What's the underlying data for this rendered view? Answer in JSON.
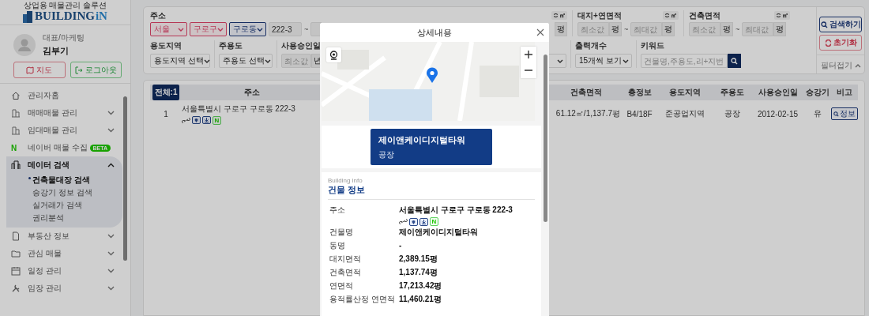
{
  "sidebar": {
    "logo": {
      "tagline": "상업용 매물관리 솔루션",
      "word": "BUILDING",
      "accent": "iN"
    },
    "user": {
      "role": "대표/마케팅",
      "name": "김부기"
    },
    "buttons": [
      {
        "label": "지도",
        "kind": "map"
      },
      {
        "label": "로그아웃",
        "kind": "logout"
      }
    ],
    "menu": [
      {
        "label": "관리자홈",
        "kind": "link"
      },
      {
        "label": "매매매물 관리",
        "kind": "group",
        "expanded": false
      },
      {
        "label": "임대매물 관리",
        "kind": "group",
        "expanded": false
      },
      {
        "label": "네이버 매물 수집",
        "kind": "link",
        "glyph": "N",
        "badge": "BETA"
      },
      {
        "label": "데이터 검색",
        "kind": "group",
        "expanded": true,
        "children": [
          {
            "label": "건축물대장 검색",
            "selected": true
          },
          {
            "label": "승강기 정보 검색",
            "selected": false
          },
          {
            "label": "실거래가 검색",
            "selected": false
          },
          {
            "label": "권리분석",
            "selected": false
          }
        ]
      },
      {
        "label": "부동산 정보",
        "kind": "group",
        "expanded": false
      },
      {
        "label": "관심 매물",
        "kind": "group",
        "expanded": false
      },
      {
        "label": "일정 관리",
        "kind": "group",
        "expanded": false
      },
      {
        "label": "임장 관리",
        "kind": "group",
        "expanded": false
      }
    ]
  },
  "filters": {
    "address": {
      "label": "주소",
      "selects": [
        {
          "value": "서울",
          "kind": "warning"
        },
        {
          "value": "구로구",
          "kind": "warning"
        },
        {
          "value": "구로동",
          "kind": "focus"
        }
      ],
      "lot_from": "222-3",
      "tilde": "~"
    },
    "floor_area_tail": {
      "unit_toggle": "㎡",
      "unit": "평"
    },
    "ranges": [
      {
        "label": "대지+연면적",
        "unit_toggle": "㎡",
        "min_placeholder": "최소값",
        "min_unit": "평",
        "tilde": "~",
        "max_placeholder": "최대값",
        "max_unit": "평"
      },
      {
        "label": "건축면적",
        "unit_toggle": "㎡",
        "min_placeholder": "최소값",
        "min_unit": "평",
        "tilde": "~",
        "max_placeholder": "최대값",
        "max_unit": "평"
      }
    ],
    "zoning": {
      "label": "용도지역",
      "value": "용도지역 선택"
    },
    "main_use": {
      "label": "주용도",
      "value": "주용도 선택"
    },
    "approval": {
      "label": "사용승인일",
      "min_placeholder": "최소값",
      "unit": "년"
    },
    "page_size": {
      "label": "출력개수",
      "value": "15개씩 보기"
    },
    "keyword": {
      "label": "키워드",
      "placeholder": "건물명,주용도,리+지번"
    },
    "actions": [
      {
        "label": "검색하기",
        "kind": "search"
      },
      {
        "label": "초기화",
        "kind": "reset"
      }
    ],
    "collapse": {
      "label": "필터접기"
    }
  },
  "table": {
    "total_badge": "전체:1",
    "columns": [
      "주소",
      "건축면적",
      "층정보",
      "용도지역",
      "주용도",
      "사용승인일",
      "승강기",
      "비고"
    ],
    "rows": [
      {
        "no": "1",
        "address": "서울특별시 구로구 구로동 222-3",
        "naver_badge": "N",
        "building_area": "61.12㎡/1,137.7평",
        "floors": "B4/18F",
        "zoning": "준공업지역",
        "main_use": "공장",
        "approval_date": "2012-02-15",
        "elevator": "유",
        "note_button": "정보"
      }
    ]
  },
  "modal": {
    "title": "상세내용",
    "card": {
      "name": "제이앤케이디지털타워",
      "use": "공장"
    },
    "section": {
      "eyebrow": "Building info",
      "title": "건물 정보"
    },
    "fields": [
      {
        "label": "주소",
        "value": "서울특별시 구로구 구로동 222-3",
        "kind": "address",
        "naver_badge": "N"
      },
      {
        "label": "건물명",
        "value": "제이앤케이디지털타워",
        "kind": "text"
      },
      {
        "label": "동명",
        "value": "-",
        "kind": "text"
      },
      {
        "label": "대지면적",
        "value": "2,389.15평",
        "kind": "text"
      },
      {
        "label": "건축면적",
        "value": "1,137.74평",
        "kind": "text"
      },
      {
        "label": "연면적",
        "value": "17,213.42평",
        "kind": "text"
      },
      {
        "label": "용적률산정 연면적",
        "value": "11,460.21평",
        "kind": "text"
      }
    ]
  }
}
